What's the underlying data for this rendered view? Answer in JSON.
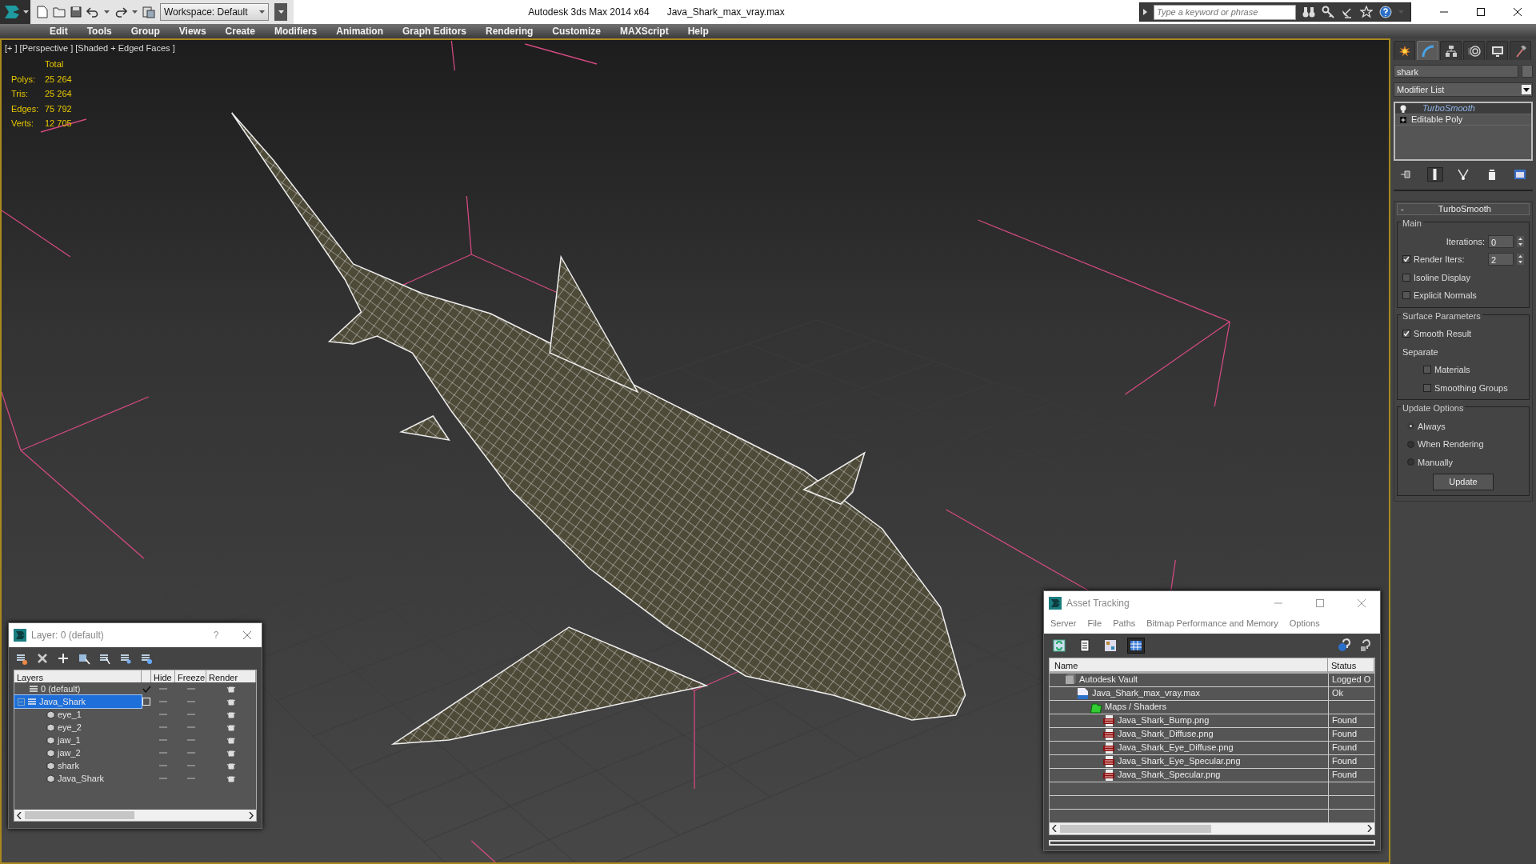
{
  "title_bar": {
    "workspace": "Workspace: Default",
    "app_title": "Autodesk 3ds Max  2014 x64",
    "file_name": "Java_Shark_max_vray.max",
    "search": {
      "placeholder": "Type a keyword or phrase"
    }
  },
  "menu_bar": [
    "Edit",
    "Tools",
    "Group",
    "Views",
    "Create",
    "Modifiers",
    "Animation",
    "Graph Editors",
    "Rendering",
    "Customize",
    "MAXScript",
    "Help"
  ],
  "viewport": {
    "labels": [
      "[+ ]",
      "[Perspective ]",
      "[Shaded + Edged Faces ]"
    ],
    "stats": {
      "heading": "Total",
      "rows": [
        {
          "label": "Polys:",
          "value": "25 264"
        },
        {
          "label": "Tris:",
          "value": "25 264"
        },
        {
          "label": "Edges:",
          "value": "75 792"
        },
        {
          "label": "Verts:",
          "value": "12 705"
        }
      ]
    }
  },
  "command_panel": {
    "tabs": [
      {
        "kind": "create",
        "selected": false
      },
      {
        "kind": "modify",
        "selected": true
      },
      {
        "kind": "hierarchy",
        "selected": false
      },
      {
        "kind": "motion",
        "selected": false
      },
      {
        "kind": "display",
        "selected": false
      },
      {
        "kind": "utilities",
        "selected": false
      }
    ],
    "object_name": "shark",
    "modifier_list": "Modifier List",
    "stack": [
      {
        "label": "TurboSmooth",
        "kind": "modifier",
        "selected": true
      },
      {
        "label": "Editable Poly",
        "kind": "base",
        "selected": false
      }
    ],
    "stack_tools": [
      {
        "kind": "pin",
        "selected": false
      },
      {
        "kind": "end-result",
        "selected": true
      },
      {
        "kind": "unique",
        "selected": false
      },
      {
        "kind": "remove",
        "selected": false
      },
      {
        "kind": "configure",
        "selected": false
      }
    ],
    "rollout": {
      "sign": "-",
      "title": "TurboSmooth",
      "groups": [
        {
          "title": "Main",
          "controls": [
            {
              "kind": "spinner",
              "label": "Iterations:",
              "value": "0"
            },
            {
              "kind": "checkbox-spinner",
              "label": "Render Iters:",
              "checked": true,
              "value": "2"
            },
            {
              "kind": "checkbox",
              "label": "Isoline Display",
              "checked": false
            },
            {
              "kind": "checkbox",
              "label": "Explicit Normals",
              "checked": false
            }
          ]
        },
        {
          "title": "Surface Parameters",
          "controls": [
            {
              "kind": "checkbox",
              "label": "Smooth Result",
              "checked": true
            },
            {
              "kind": "label",
              "label": "Separate",
              "children": [
                {
                  "kind": "checkbox",
                  "label": "Materials",
                  "checked": false
                },
                {
                  "kind": "checkbox",
                  "label": "Smoothing Groups",
                  "checked": false
                }
              ]
            }
          ]
        },
        {
          "title": "Update Options",
          "controls": [
            {
              "kind": "radio",
              "label": "Always",
              "selected": true
            },
            {
              "kind": "radio",
              "label": "When Rendering",
              "selected": false
            },
            {
              "kind": "radio",
              "label": "Manually",
              "selected": false
            },
            {
              "kind": "button",
              "label": "Update"
            }
          ]
        }
      ]
    }
  },
  "layer_dialog": {
    "title": "Layer: 0 (default)",
    "help": "?",
    "columns": [
      "Layers",
      "Hide",
      "Freeze",
      "Render"
    ],
    "rows": [
      {
        "kind": "layer",
        "label": "0 (default)",
        "current": true,
        "selected": false
      },
      {
        "kind": "layer",
        "label": "Java_Shark",
        "current": false,
        "selected": true,
        "expanded": true,
        "children": [
          {
            "kind": "object",
            "label": "eye_1",
            "selected": false
          },
          {
            "kind": "object",
            "label": "eye_2",
            "selected": false
          },
          {
            "kind": "object",
            "label": "jaw_1",
            "selected": false
          },
          {
            "kind": "object",
            "label": "jaw_2",
            "selected": false
          },
          {
            "kind": "object",
            "label": "shark",
            "selected": false
          },
          {
            "kind": "object",
            "label": "Java_Shark",
            "selected": false
          }
        ]
      }
    ]
  },
  "asset_tracking": {
    "title": "Asset Tracking",
    "menu": [
      "Server",
      "File",
      "Paths",
      "Bitmap Performance and Memory",
      "Options"
    ],
    "toolbar": [
      {
        "kind": "refresh",
        "selected": false
      },
      {
        "kind": "list",
        "selected": false
      },
      {
        "kind": "thumbnails",
        "selected": false
      },
      {
        "kind": "table",
        "selected": true
      }
    ],
    "columns": [
      "Name",
      "Status"
    ],
    "rows": [
      {
        "kind": "vault",
        "name": "Autodesk Vault",
        "status": "Logged O",
        "children": [
          {
            "kind": "max-file",
            "name": "Java_Shark_max_vray.max",
            "status": "Ok",
            "children": [
              {
                "kind": "folder",
                "name": "Maps / Shaders",
                "children": [
                  {
                    "kind": "png",
                    "name": "Java_Shark_Bump.png",
                    "status": "Found"
                  },
                  {
                    "kind": "png",
                    "name": "Java_Shark_Diffuse.png",
                    "status": "Found"
                  },
                  {
                    "kind": "png",
                    "name": "Java_Shark_Eye_Diffuse.png",
                    "status": "Found"
                  },
                  {
                    "kind": "png",
                    "name": "Java_Shark_Eye_Specular.png",
                    "status": "Found"
                  },
                  {
                    "kind": "png",
                    "name": "Java_Shark_Specular.png",
                    "status": "Found"
                  }
                ]
              }
            ]
          }
        ]
      }
    ]
  }
}
